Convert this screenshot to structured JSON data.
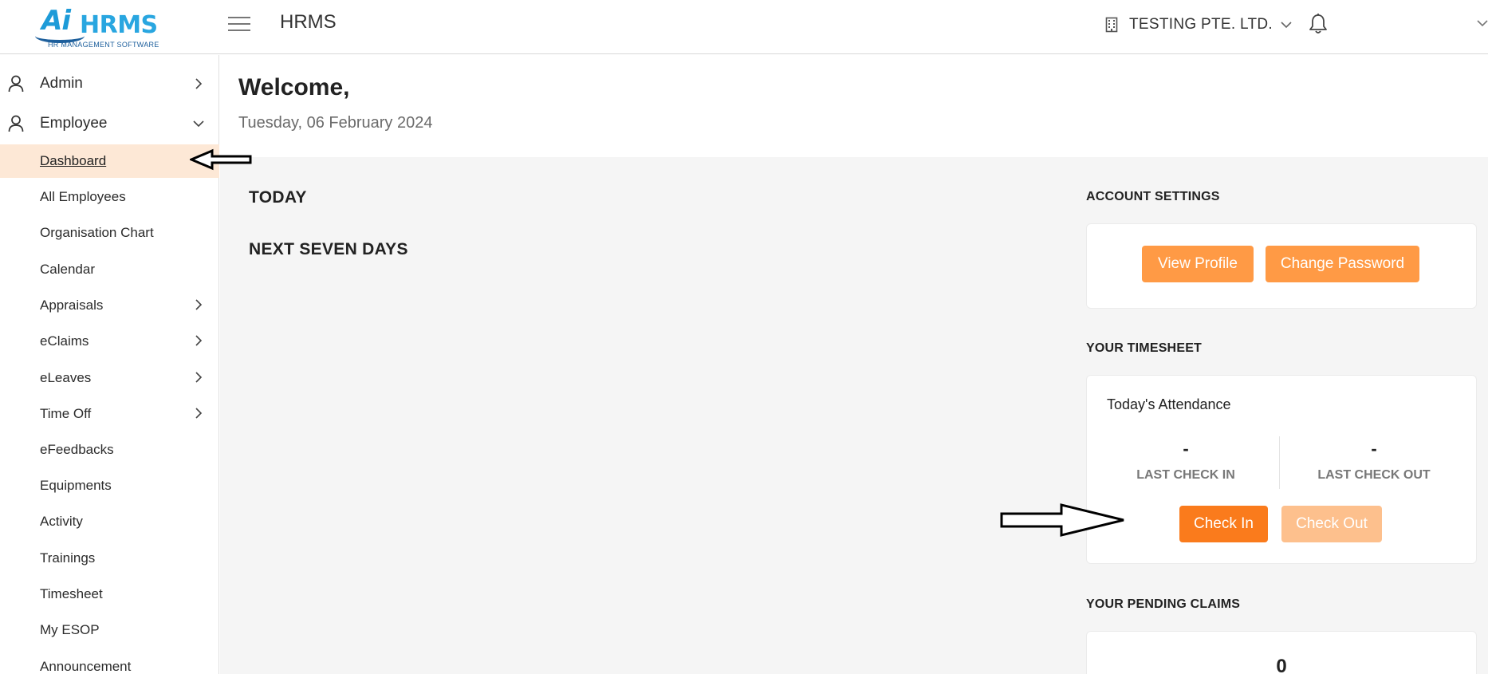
{
  "header": {
    "logo_mark": "Ai",
    "logo_word": "HRMS",
    "logo_tagline": "HR MANAGEMENT SOFTWARE",
    "app_title": "HRMS",
    "company_name": "TESTING PTE. LTD.",
    "icons": [
      "menu-icon",
      "building-icon",
      "chevron-down-icon",
      "bell-icon"
    ]
  },
  "sidebar": {
    "groups": [
      {
        "label": "Admin",
        "icon": "user-icon",
        "expanded": false
      },
      {
        "label": "Employee",
        "icon": "user-icon",
        "expanded": true
      }
    ],
    "items": [
      {
        "label": "Dashboard",
        "active": true,
        "has_children": false
      },
      {
        "label": "All Employees",
        "has_children": false
      },
      {
        "label": "Organisation Chart",
        "has_children": false
      },
      {
        "label": "Calendar",
        "has_children": false
      },
      {
        "label": "Appraisals",
        "has_children": true
      },
      {
        "label": "eClaims",
        "has_children": true
      },
      {
        "label": "eLeaves",
        "has_children": true
      },
      {
        "label": "Time Off",
        "has_children": true
      },
      {
        "label": "eFeedbacks",
        "has_children": false
      },
      {
        "label": "Equipments",
        "has_children": false
      },
      {
        "label": "Activity",
        "has_children": false
      },
      {
        "label": "Trainings",
        "has_children": false
      },
      {
        "label": "Timesheet",
        "has_children": false
      },
      {
        "label": "My ESOP",
        "has_children": false
      },
      {
        "label": "Announcement",
        "has_children": false
      }
    ]
  },
  "main": {
    "welcome": "Welcome,",
    "date": "Tuesday, 06 February 2024",
    "today_heading": "TODAY",
    "next_seven_days_heading": "NEXT SEVEN DAYS"
  },
  "account_settings": {
    "heading": "ACCOUNT SETTINGS",
    "view_profile": "View Profile",
    "change_password": "Change Password"
  },
  "timesheet": {
    "heading": "YOUR TIMESHEET",
    "attendance_title": "Today's Attendance",
    "last_check_in_value": "-",
    "last_check_in_label": "LAST CHECK IN",
    "last_check_out_value": "-",
    "last_check_out_label": "LAST CHECK OUT",
    "check_in": "Check In",
    "check_out": "Check Out",
    "check_out_enabled": false
  },
  "pending_claims": {
    "heading": "YOUR PENDING CLAIMS",
    "count": "0"
  },
  "colors": {
    "accent": "#ff9a45",
    "check_in": "#fa7b1c",
    "check_out_disabled": "#fdc08d",
    "active_menu_bg": "#fde8d6",
    "logo_blue": "#29a6e0"
  }
}
